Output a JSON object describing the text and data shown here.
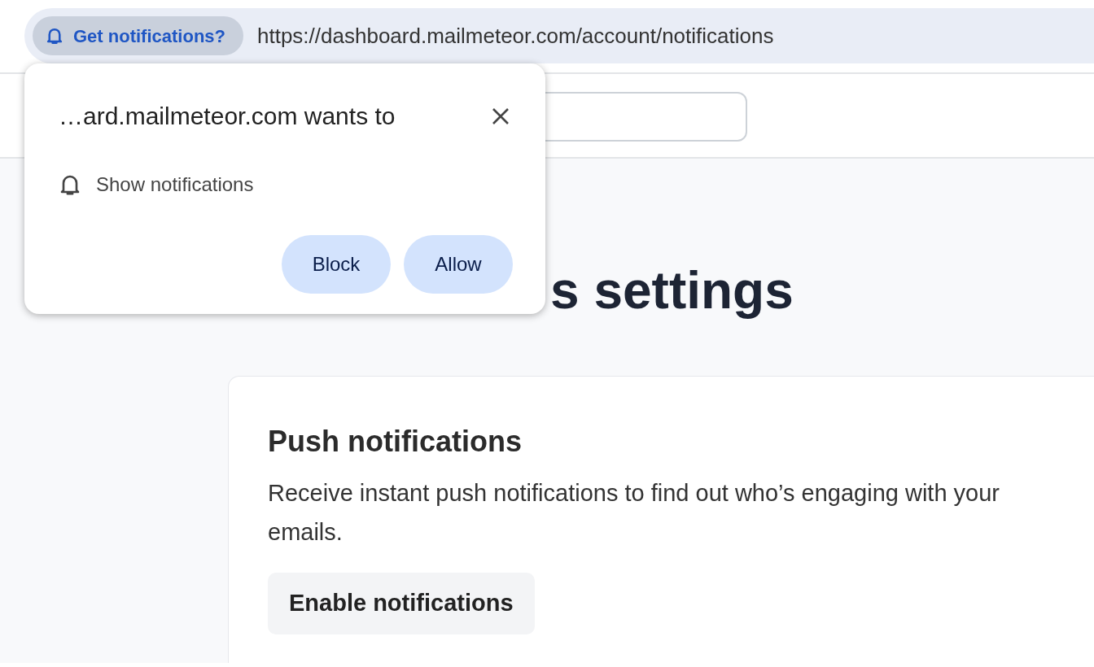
{
  "address_bar": {
    "permission_chip": {
      "label": "Get notifications?"
    },
    "url": "https://dashboard.mailmeteor.com/account/notifications"
  },
  "permission_popup": {
    "title": "…ard.mailmeteor.com wants to",
    "permission": "Show notifications",
    "buttons": [
      {
        "label": "Block"
      },
      {
        "label": "Allow"
      }
    ]
  },
  "page": {
    "heading": "s settings",
    "card": {
      "title": "Push notifications",
      "description": "Receive instant push notifications to find out who’s engaging with your emails.",
      "button": "Enable notifications"
    }
  }
}
